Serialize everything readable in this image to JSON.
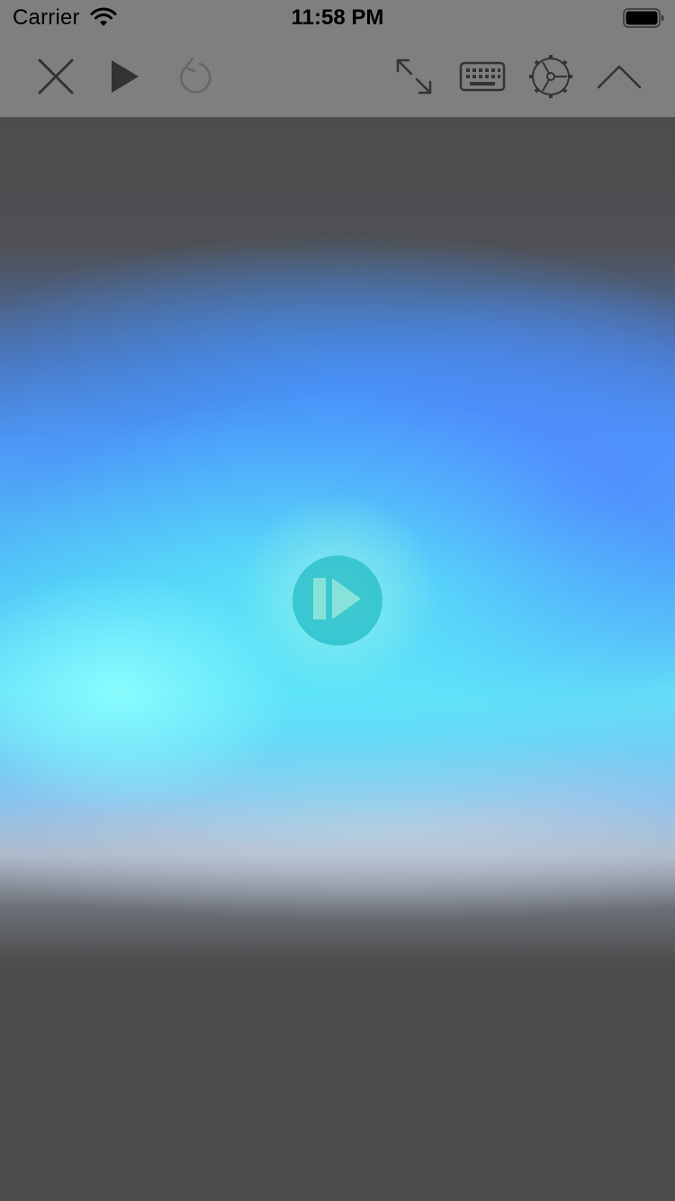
{
  "status_bar": {
    "carrier": "Carrier",
    "time": "11:58 PM",
    "wifi_icon": "wifi-icon",
    "battery_icon": "battery-full-icon"
  },
  "toolbar": {
    "close_icon": "close-icon",
    "play_icon": "play-icon",
    "reload_icon": "reload-icon",
    "expand_icon": "expand-icon",
    "keyboard_icon": "keyboard-icon",
    "settings_icon": "settings-gear-icon",
    "collapse_icon": "chevron-up-icon",
    "reload_enabled": false
  },
  "stage": {
    "resume_icon": "play-pause-icon",
    "colors": {
      "toolbar_bg": "#7f7f7f",
      "page_bg": "#4d4d4d",
      "glow_cyan": "#64dff8",
      "glow_blue": "#4f98f5",
      "button_teal": "#28bec8",
      "icon_dark": "#333333",
      "icon_disabled": "#666666"
    }
  }
}
